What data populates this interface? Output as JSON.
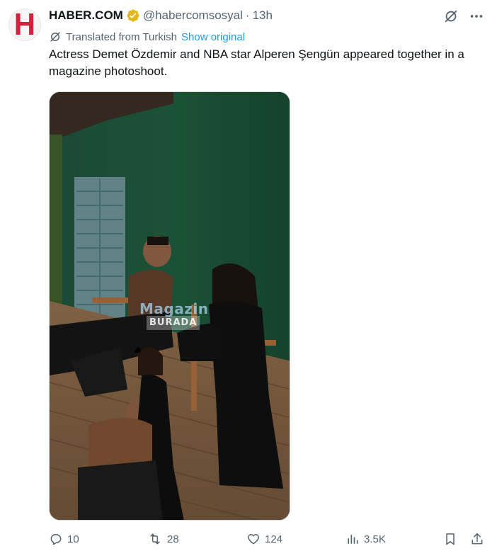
{
  "author": {
    "name": "HABER.COM",
    "avatar_letter": "H",
    "verified_icon": "verified-badge-icon",
    "handle": "@habercomsosyal",
    "separator": "·",
    "time": "13h"
  },
  "translation": {
    "label": "Translated from Turkish",
    "link": "Show original"
  },
  "text": "Actress Demet Özdemir and NBA star Alperen Şengün appeared together in a magazine photoshoot.",
  "media": {
    "watermark_top": "Magazin",
    "watermark_bottom": "BURADA"
  },
  "actions": {
    "replies": "10",
    "reposts": "28",
    "likes": "124",
    "views": "3.5K"
  },
  "colors": {
    "brand": "#d4213d",
    "link": "#1d9bf0",
    "muted": "#536471",
    "verified": "#e2b719"
  }
}
